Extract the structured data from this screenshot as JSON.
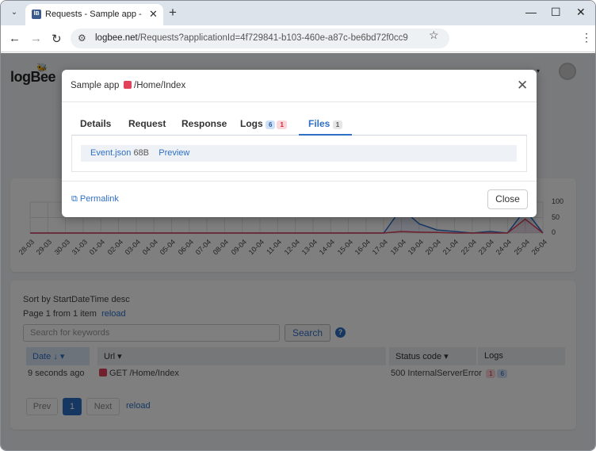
{
  "browser": {
    "tab_title": "Requests - Sample app - logBee",
    "favicon_text": "lB",
    "url_domain": "logbee.net",
    "url_path": "/Requests?applicationId=4f729841-b103-460e-a87c-be6bd72f0cc9"
  },
  "header": {
    "logo": "logBee"
  },
  "chart_data": {
    "type": "line",
    "categories": [
      "28-03",
      "29-03",
      "30-03",
      "31-03",
      "01-04",
      "02-04",
      "03-04",
      "04-04",
      "05-04",
      "06-04",
      "07-04",
      "08-04",
      "09-04",
      "10-04",
      "11-04",
      "12-04",
      "13-04",
      "14-04",
      "15-04",
      "16-04",
      "17-04",
      "18-04",
      "19-04",
      "20-04",
      "21-04",
      "22-04",
      "23-04",
      "24-04",
      "25-04",
      "26-04"
    ],
    "yticks": [
      "100",
      "50",
      "0"
    ],
    "ylim": [
      0,
      100
    ],
    "series": [
      {
        "color": "#2f6fc6",
        "values": [
          0,
          0,
          0,
          0,
          0,
          0,
          0,
          0,
          0,
          0,
          0,
          0,
          0,
          0,
          0,
          0,
          0,
          0,
          0,
          0,
          0,
          80,
          30,
          10,
          5,
          0,
          5,
          0,
          75,
          0
        ]
      },
      {
        "color": "#e0435a",
        "values": [
          0,
          0,
          0,
          0,
          0,
          0,
          0,
          0,
          0,
          0,
          0,
          0,
          0,
          0,
          0,
          0,
          0,
          0,
          0,
          0,
          0,
          5,
          3,
          2,
          0,
          0,
          0,
          0,
          45,
          0
        ]
      }
    ]
  },
  "list": {
    "sort_text": "Sort by StartDateTime desc",
    "page_text": "Page 1 from 1 item",
    "reload": "reload",
    "search_placeholder": "Search for keywords",
    "search_button": "Search",
    "help": "?",
    "columns": {
      "date": "Date",
      "url": "Url",
      "status": "Status code",
      "logs": "Logs"
    },
    "row": {
      "date": "9 seconds ago",
      "url": "GET /Home/Index",
      "status": "500 InternalServerError",
      "badge_red": "1",
      "badge_blue": "6"
    },
    "pager": {
      "prev": "Prev",
      "current": "1",
      "next": "Next",
      "reload": "reload"
    }
  },
  "modal": {
    "app": "Sample app",
    "route": "/Home/Index",
    "tabs": {
      "details": "Details",
      "request": "Request",
      "response": "Response",
      "logs": "Logs",
      "logs_badge_blue": "6",
      "logs_badge_red": "1",
      "files": "Files",
      "files_badge": "1"
    },
    "file": {
      "name": "Event.json",
      "size": "68B",
      "preview": "Preview"
    },
    "permalink": "Permalink",
    "close": "Close"
  }
}
